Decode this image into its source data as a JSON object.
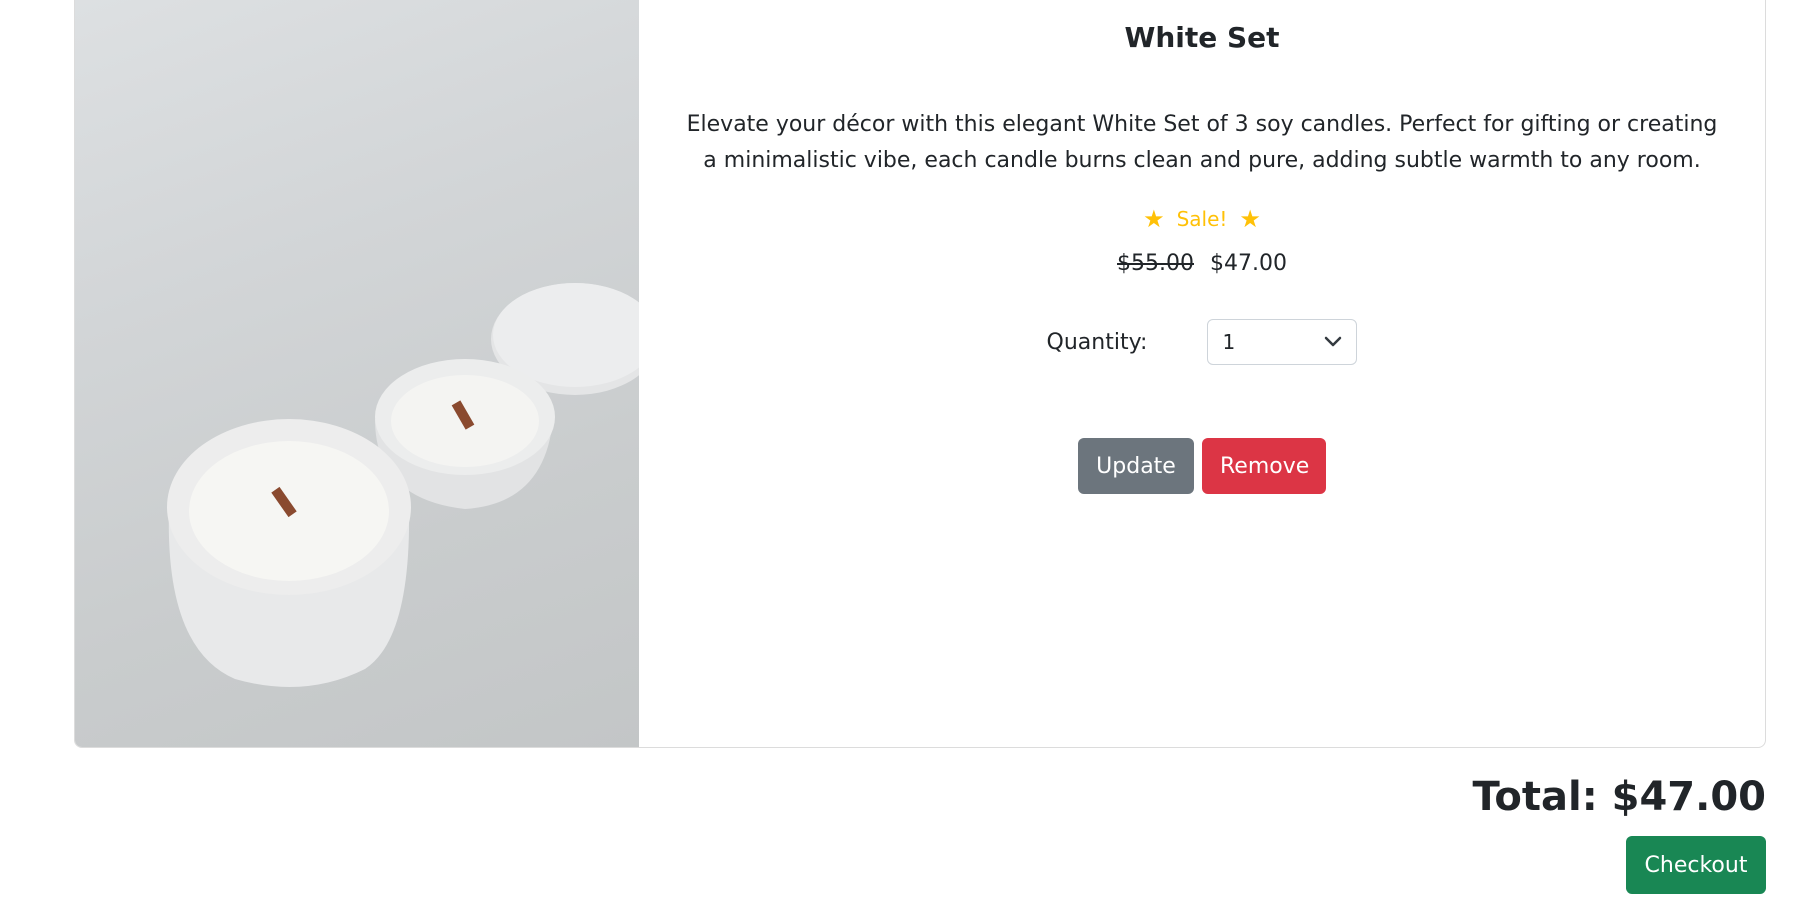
{
  "product": {
    "title": "White Set",
    "description": "Elevate your décor with this elegant White Set of 3 soy candles. Perfect for gifting or creating a minimalistic vibe, each candle burns clean and pure, adding subtle warmth to any room.",
    "sale_label": "Sale!",
    "old_price": "$55.00",
    "new_price": "$47.00",
    "quantity_label": "Quantity:",
    "quantity_value": "1",
    "update_label": "Update",
    "remove_label": "Remove",
    "image_alt": "White candle set"
  },
  "summary": {
    "total": "Total: $47.00",
    "checkout_label": "Checkout"
  },
  "colors": {
    "sale": "#ffc107",
    "update": "#6c757d",
    "remove": "#dc3545",
    "checkout": "#198754"
  },
  "icons": {
    "sale_left": "star-icon",
    "sale_right": "star-icon",
    "select_caret": "chevron-down-icon"
  }
}
